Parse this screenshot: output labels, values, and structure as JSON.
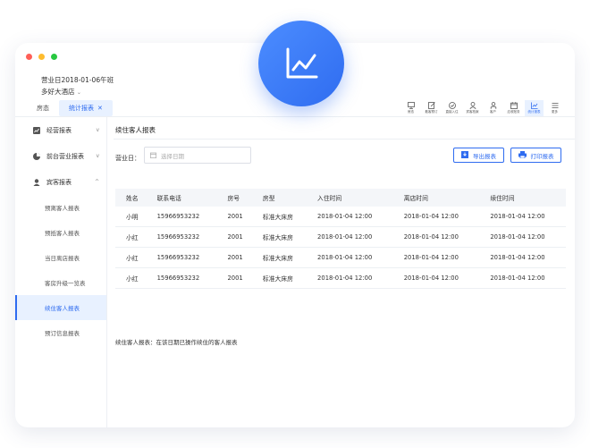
{
  "window": {
    "dots": [
      "#ff5f57",
      "#febc2e",
      "#28c840"
    ]
  },
  "badge": {
    "icon": "line-chart-icon",
    "color": "#2f6cf0"
  },
  "header": {
    "business_date": "营业日2018-01-06午班",
    "hotel_name": "多好大酒店"
  },
  "tabs": [
    {
      "label": "房态"
    },
    {
      "label": "统计报表",
      "active": true
    }
  ],
  "toolbar": [
    {
      "label": "房态",
      "icon": "monitor-icon"
    },
    {
      "label": "散客预订",
      "icon": "edit-icon"
    },
    {
      "label": "直接入住",
      "icon": "check-circle-icon"
    },
    {
      "label": "宾客档案",
      "icon": "user-icon"
    },
    {
      "label": "客户",
      "icon": "person-icon"
    },
    {
      "label": "应收账务",
      "icon": "calendar-icon"
    },
    {
      "label": "统计报表",
      "icon": "line-chart-icon",
      "active": true
    },
    {
      "label": "更多",
      "icon": "menu-icon"
    }
  ],
  "sidebar": {
    "groups": [
      {
        "label": "经营报表",
        "icon": "chart-icon",
        "chevron": "v"
      },
      {
        "label": "前台营业报表",
        "icon": "pie-icon",
        "chevron": "v"
      },
      {
        "label": "宾客报表",
        "icon": "user-icon",
        "chevron": "^"
      }
    ],
    "items": [
      {
        "label": "预离客人报表"
      },
      {
        "label": "预抵客人报表"
      },
      {
        "label": "当日离店报表"
      },
      {
        "label": "客房升级一览表"
      },
      {
        "label": "续住客人报表",
        "active": true
      },
      {
        "label": "预订信息报表"
      }
    ]
  },
  "main": {
    "title": "续住客人报表",
    "date_label": "营业日：",
    "date_placeholder": "选择日期",
    "export_label": "导出报表",
    "print_label": "打印报表",
    "columns": [
      "姓名",
      "联系电话",
      "房号",
      "房型",
      "入住时间",
      "离店时间",
      "续住时间"
    ],
    "rows": [
      [
        "小明",
        "15966953232",
        "2001",
        "标准大床房",
        "2018-01-04 12:00",
        "2018-01-04 12:00",
        "2018-01-04 12:00"
      ],
      [
        "小红",
        "15966953232",
        "2001",
        "标准大床房",
        "2018-01-04 12:00",
        "2018-01-04 12:00",
        "2018-01-04 12:00"
      ],
      [
        "小红",
        "15966953232",
        "2001",
        "标准大床房",
        "2018-01-04 12:00",
        "2018-01-04 12:00",
        "2018-01-04 12:00"
      ],
      [
        "小红",
        "15966953232",
        "2001",
        "标准大床房",
        "2018-01-04 12:00",
        "2018-01-04 12:00",
        "2018-01-04 12:00"
      ]
    ],
    "note": "续住客人报表：在该日期已操作续住的客人报表"
  }
}
